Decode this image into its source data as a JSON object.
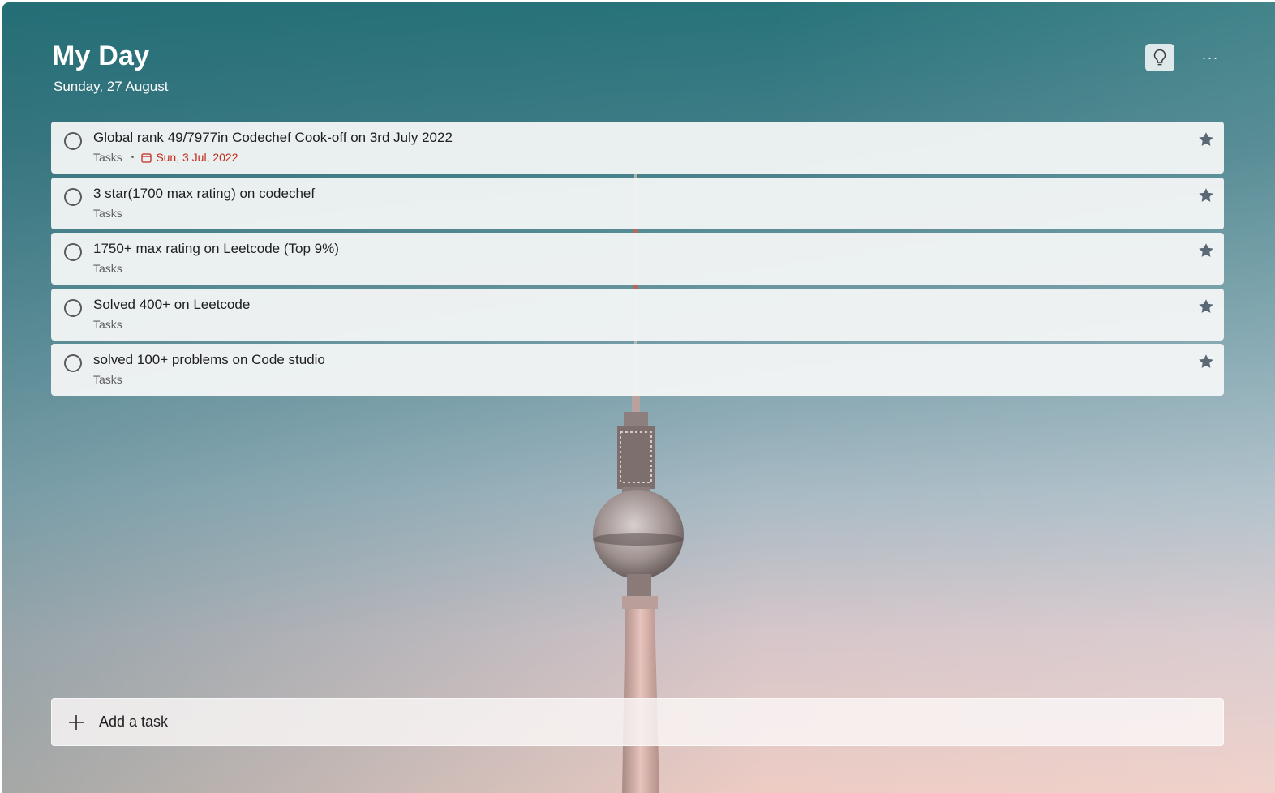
{
  "header": {
    "title": "My Day",
    "date": "Sunday, 27 August"
  },
  "toolbar": {
    "suggestions_icon": "lightbulb-icon",
    "more_icon": "more-options-icon",
    "more_label": "···"
  },
  "tasks": [
    {
      "title": "Global rank 49/7977in Codechef Cook-off on 3rd July 2022",
      "list": "Tasks",
      "due": "Sun, 3 Jul, 2022",
      "due_separator": "•",
      "important_icon": "star-icon"
    },
    {
      "title": "3 star(1700 max rating) on codechef",
      "list": "Tasks",
      "important_icon": "star-icon"
    },
    {
      "title": "1750+ max rating on Leetcode (Top 9%)",
      "list": "Tasks",
      "important_icon": "star-icon"
    },
    {
      "title": "Solved 400+ on Leetcode",
      "list": "Tasks",
      "important_icon": "star-icon"
    },
    {
      "title": "solved 100+ problems on Code studio",
      "list": "Tasks",
      "important_icon": "star-icon"
    }
  ],
  "add_task": {
    "label": "Add a task",
    "icon": "plus-icon"
  },
  "colors": {
    "due_overdue": "#c42b1c",
    "star": "#5b6876",
    "text_primary": "#1f1f1f",
    "text_secondary": "#5f5f5f"
  }
}
